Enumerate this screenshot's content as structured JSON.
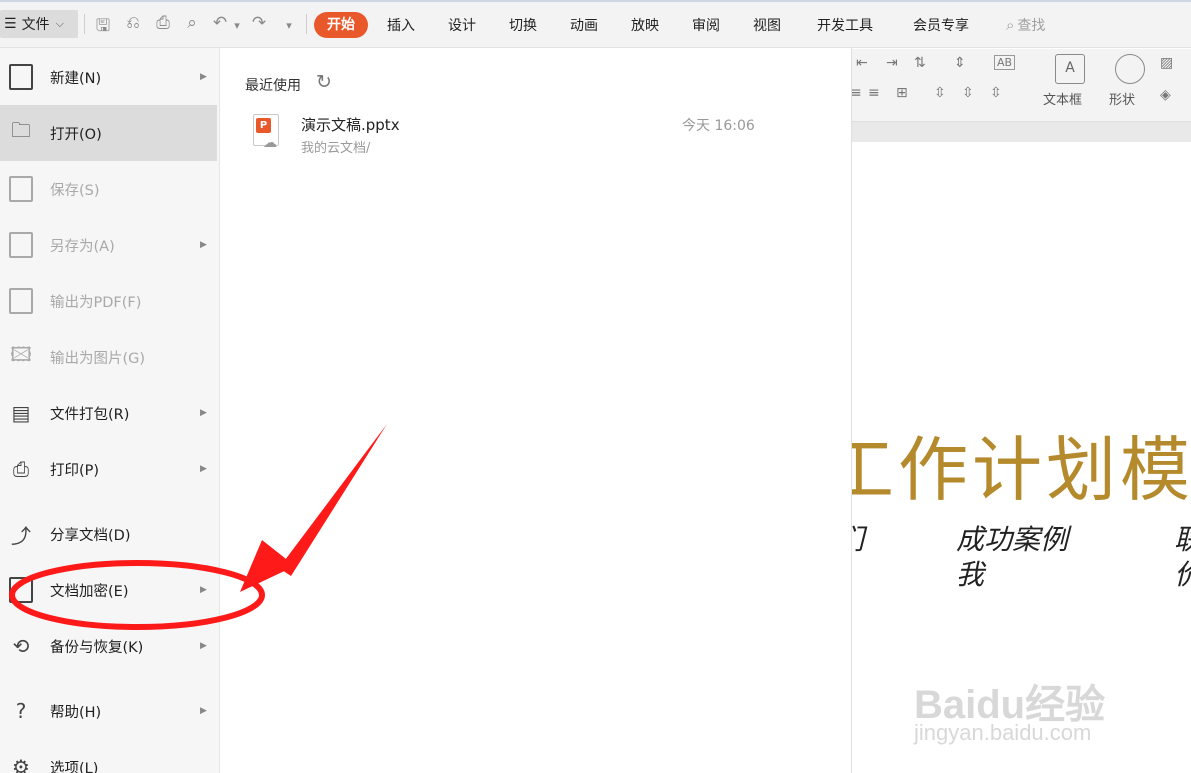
{
  "toolbar": {
    "file_label": "文件",
    "tabs": [
      "开始",
      "插入",
      "设计",
      "切换",
      "动画",
      "放映",
      "审阅",
      "视图",
      "开发工具",
      "会员专享"
    ],
    "search_label": "查找"
  },
  "ribbon": {
    "textbox_label": "文本框",
    "shape_label": "形状"
  },
  "file_menu": {
    "items": [
      {
        "label": "新建(N)",
        "icon": "new-document-icon",
        "enabled": true,
        "submenu": true
      },
      {
        "label": "打开(O)",
        "icon": "open-folder-icon",
        "enabled": true,
        "submenu": false,
        "active": true
      },
      {
        "label": "保存(S)",
        "icon": "save-icon",
        "enabled": false,
        "submenu": false
      },
      {
        "label": "另存为(A)",
        "icon": "save-as-icon",
        "enabled": false,
        "submenu": true
      },
      {
        "label": "输出为PDF(F)",
        "icon": "export-pdf-icon",
        "enabled": false,
        "submenu": false
      },
      {
        "label": "输出为图片(G)",
        "icon": "export-image-icon",
        "enabled": false,
        "submenu": false
      },
      {
        "label": "文件打包(R)",
        "icon": "package-icon",
        "enabled": true,
        "submenu": true
      },
      {
        "label": "打印(P)",
        "icon": "printer-icon",
        "enabled": true,
        "submenu": true
      },
      {
        "label": "分享文档(D)",
        "icon": "share-icon",
        "enabled": true,
        "submenu": false
      },
      {
        "label": "文档加密(E)",
        "icon": "encrypt-document-icon",
        "enabled": true,
        "submenu": true
      },
      {
        "label": "备份与恢复(K)",
        "icon": "backup-restore-icon",
        "enabled": true,
        "submenu": true
      },
      {
        "label": "帮助(H)",
        "icon": "help-icon",
        "enabled": true,
        "submenu": true
      },
      {
        "label": "选项(L)",
        "icon": "settings-gear-icon",
        "enabled": true,
        "submenu": false
      }
    ]
  },
  "recent": {
    "header": "最近使用",
    "files": [
      {
        "name": "演示文稿.pptx",
        "path": "我的云文档/",
        "time": "今天 16:06",
        "icon": "pptx-file-icon"
      }
    ]
  },
  "slide": {
    "title": "工作计划模",
    "item_left": "们",
    "item_middle_line1": "成功案例",
    "item_middle_line2": "我",
    "item_right_line1": "联",
    "item_right_line2": "价"
  },
  "watermark": {
    "brand": "Baidu经验",
    "url": "jingyan.baidu.com"
  },
  "colors": {
    "accent": "#e9582a",
    "slide_title": "#b48a2c",
    "annotation": "#ff1a1a"
  }
}
